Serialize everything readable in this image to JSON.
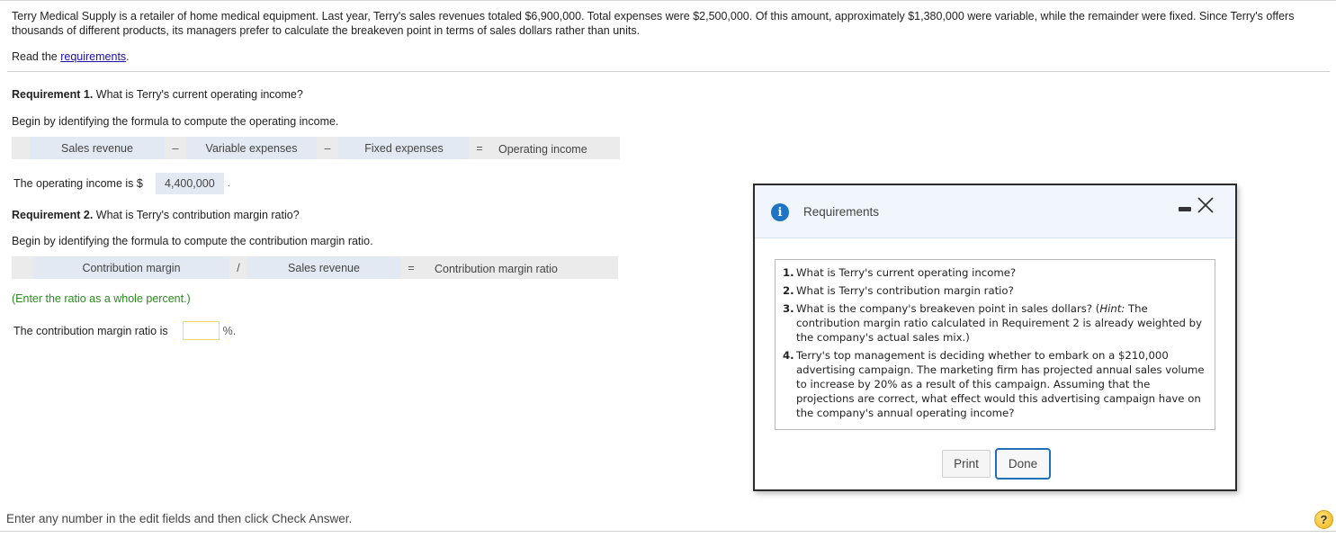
{
  "intro": {
    "paragraph": "Terry Medical Supply is a retailer of home medical equipment. Last year, Terry's sales revenues totaled $6,900,000. Total expenses were $2,500,000. Of this amount, approximately $1,380,000 were variable, while the remainder were fixed. Since Terry's offers thousands of different products, its managers prefer to calculate the breakeven point in terms of sales dollars rather than units.",
    "read_prefix": "Read the ",
    "read_link": "requirements",
    "read_suffix": "."
  },
  "requirement1": {
    "label": "Requirement 1.",
    "question": " What is Terry's current operating income?",
    "instruction": "Begin by identifying the formula to compute the operating income.",
    "formula": {
      "term1": "Sales revenue",
      "op1": "–",
      "term2": "Variable expenses",
      "op2": "–",
      "term3": "Fixed expenses",
      "eq": "=",
      "result": "Operating income"
    },
    "answer_prefix": "The operating income is $",
    "answer_value": "4,400,000",
    "answer_suffix": "."
  },
  "requirement2": {
    "label": "Requirement 2.",
    "question": " What is Terry's contribution margin ratio?",
    "instruction": "Begin by identifying the formula to compute the contribution margin ratio.",
    "formula": {
      "term1": "Contribution margin",
      "op1": "/",
      "term2": "Sales revenue",
      "eq": "=",
      "result": "Contribution margin ratio"
    },
    "note": "(Enter the ratio as a whole percent.)",
    "answer_prefix": "The contribution margin ratio is",
    "answer_value": "",
    "answer_suffix": "%."
  },
  "footer": {
    "instruction": "Enter any number in the edit fields and then click Check Answer.",
    "help_label": "?"
  },
  "modal": {
    "title": "Requirements",
    "info_glyph": "i",
    "items": [
      {
        "num": "1.",
        "text": "What is Terry's current operating income?"
      },
      {
        "num": "2.",
        "text": "What is Terry's contribution margin ratio?"
      },
      {
        "num": "3.",
        "text_before": "What is the company's breakeven point in sales dollars? (",
        "hint": "Hint:",
        "text_after": " The contribution margin ratio calculated in Requirement 2 is already weighted by the company's actual sales mix.)"
      },
      {
        "num": "4.",
        "text": "Terry's top management is deciding whether to embark on a $210,000 advertising campaign. The marketing firm has projected annual sales volume to increase by 20% as a result of this campaign. Assuming that the projections are correct, what effect would this advertising campaign have on the company's annual operating income?"
      }
    ],
    "print_label": "Print",
    "done_label": "Done"
  },
  "colors": {
    "link": "#1a0dab",
    "note_green": "#2a8a1e",
    "formula_blank": "#e3e9f2",
    "formula_row": "#ebebeb",
    "info_blue": "#1f74c4",
    "done_border": "#1d6fb8",
    "help_yellow": "#f2b418"
  }
}
